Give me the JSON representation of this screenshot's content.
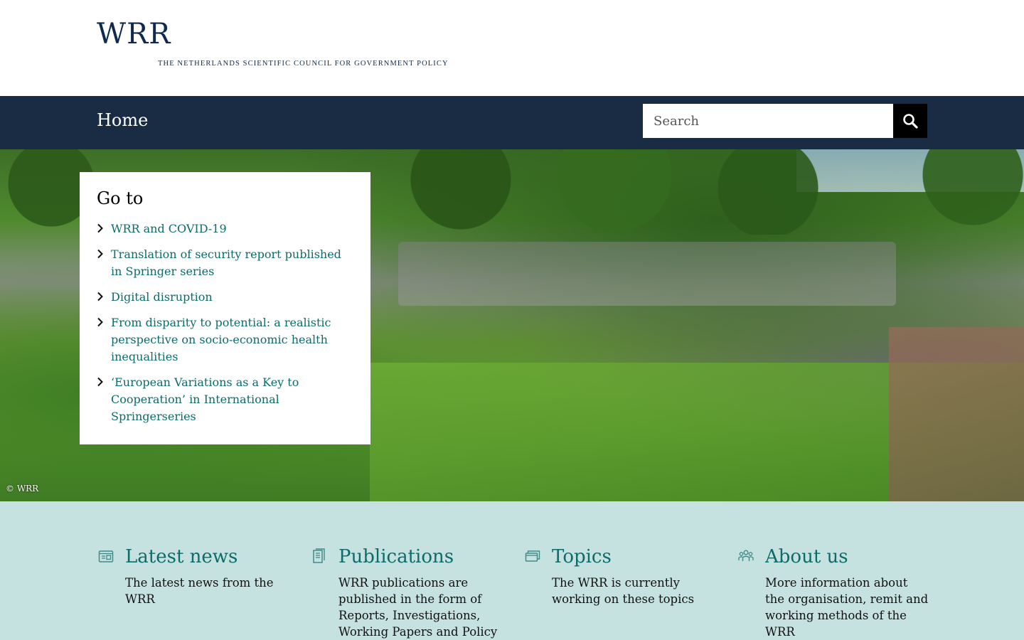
{
  "header": {
    "logo_text": "WRR",
    "logo_subtitle": "THE NETHERLANDS SCIENTIFIC COUNCIL FOR GOVERNMENT POLICY"
  },
  "nav": {
    "home_label": "Home",
    "search": {
      "placeholder": "Search",
      "value": ""
    }
  },
  "hero": {
    "credit": "© WRR"
  },
  "goto": {
    "title": "Go to",
    "links": [
      {
        "label": "WRR and COVID-19"
      },
      {
        "label": "Translation of security report published in Springer series"
      },
      {
        "label": "Digital disruption"
      },
      {
        "label": "From disparity to potential: a realistic perspective on socio-economic health inequalities"
      },
      {
        "label": "‘European Variations as a Key to Cooperation’ in International Springerseries"
      }
    ]
  },
  "info_cards": [
    {
      "icon": "news-icon",
      "title": "Latest news",
      "description": "The latest news from the WRR"
    },
    {
      "icon": "book-icon",
      "title": "Publications",
      "description": "WRR publications are published in the form of Reports, Investigations, Working Papers and Policy"
    },
    {
      "icon": "folder-icon",
      "title": "Topics",
      "description": "The WRR is currently working on these topics"
    },
    {
      "icon": "people-icon",
      "title": "About us",
      "description": "More information about the organisation, remit and working methods of the WRR"
    }
  ],
  "colors": {
    "navy": "#1a2c44",
    "teal_link": "#0d6b6b",
    "mint_background": "#c6e2e0",
    "logo_blue": "#0f2a4d"
  }
}
